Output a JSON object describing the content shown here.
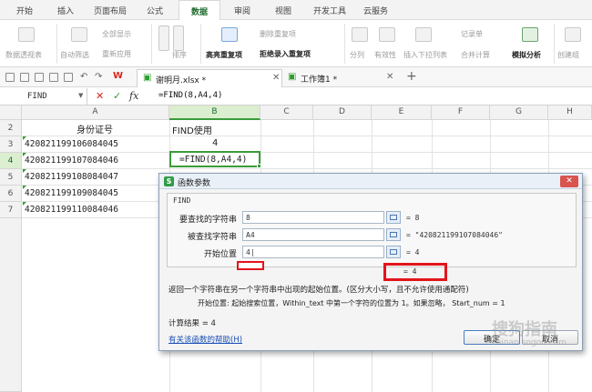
{
  "ribbon_tabs": [
    "开始",
    "插入",
    "页面布局",
    "公式",
    "数据",
    "审阅",
    "视图",
    "开发工具",
    "云服务"
  ],
  "active_tab": "数据",
  "ribbon": {
    "pivot": "数据透视表",
    "autofilter": "自动筛选",
    "show_all": "全部显示",
    "reapply": "重新应用",
    "sort": "排序",
    "highlight_dup": "高亮重复项",
    "remove_dup": "删除重复项",
    "reject_dup": "拒绝录入重复项",
    "split": "分列",
    "validity": "有效性",
    "insert_dropdown": "插入下拉列表",
    "merge_calc": "合并计算",
    "record": "记录单",
    "simulate": "模拟分析",
    "create_group": "创建组"
  },
  "doc_tabs": {
    "file": "谢明月.xlsx *",
    "book": "工作簿1 *",
    "add": "+"
  },
  "formula_bar": {
    "name_box": "FIND",
    "cancel": "✕",
    "confirm": "✓",
    "fx": "fx",
    "formula": "=FIND(8,A4,4)"
  },
  "columns": [
    "A",
    "B",
    "C",
    "D",
    "E",
    "F",
    "G",
    "H"
  ],
  "rows": [
    "2",
    "3",
    "4",
    "5",
    "6",
    "7"
  ],
  "cells": {
    "a2": "身份证号",
    "b2": "FIND使用",
    "a3": "420821199106084045",
    "b3": "4",
    "a4": "420821199107084046",
    "b4": "=FIND(8,A4,4)",
    "a5": "420821199108084047",
    "a6": "420821199109084045",
    "a7": "420821199110084046"
  },
  "dialog": {
    "title": "函数参数",
    "close": "✕",
    "function_name": "FIND",
    "args": [
      {
        "label": "要查找的字符串",
        "value": "8",
        "result": "= 8"
      },
      {
        "label": "被查找字符串",
        "value": "A4",
        "result": "= \"420821199107084046\""
      },
      {
        "label": "开始位置",
        "value": "4|",
        "result": "= 4"
      }
    ],
    "inline_result": "= 4",
    "description": "返回一个字符串在另一个字符串中出现的起始位置。(区分大小写，且不允许使用通配符)",
    "arg_help": "开始位置:  起始搜索位置，Within_text 中第一个字符的位置为 1。如果忽略， Start_num = 1",
    "calc_result": "计算结果 = 4",
    "help_link": "有关该函数的帮助(H)",
    "ok": "确定",
    "cancel": "取消"
  },
  "watermark": "搜狗指南",
  "watermark_url": "zhinan.sogou.com",
  "colors": {
    "accent": "#2e9d2e",
    "highlight": "#e2141c"
  }
}
